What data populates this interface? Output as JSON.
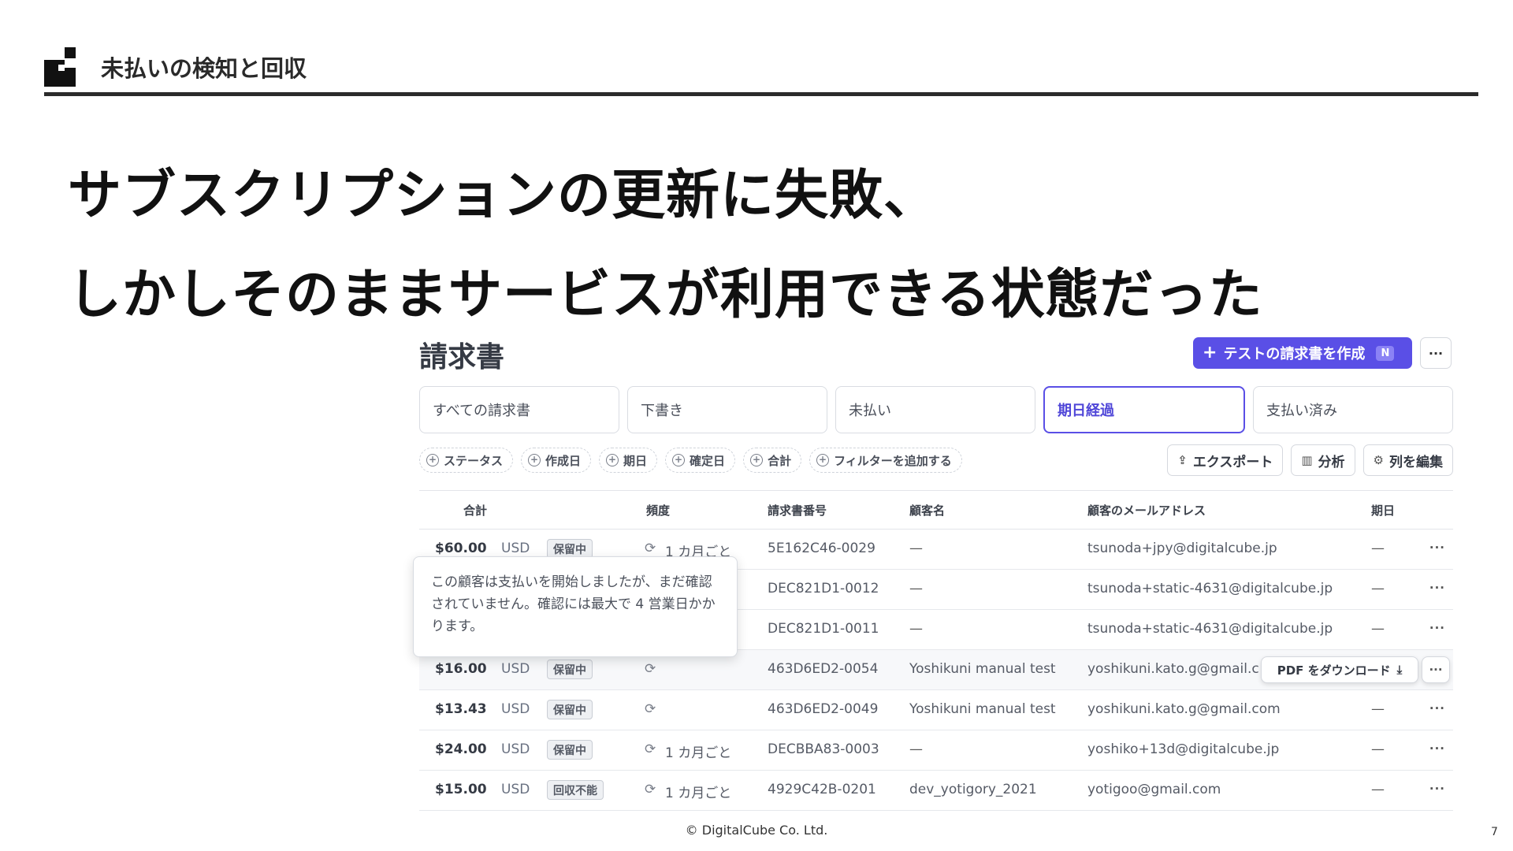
{
  "slide": {
    "section_title": "未払いの検知と回収",
    "headline_1": "サブスクリプションの更新に失敗、",
    "headline_2": "しかしそのままサービスが利用できる状態だった",
    "footer": "© DigitalCube Co. Ltd.",
    "page_number": "7"
  },
  "invoices": {
    "title": "請求書",
    "create_button": "テストの請求書を作成",
    "create_badge": "N",
    "more_label": "···",
    "tabs": [
      "すべての請求書",
      "下書き",
      "未払い",
      "期日経過",
      "支払い済み"
    ],
    "active_tab": "期日経過",
    "filters": [
      "ステータス",
      "作成日",
      "期日",
      "確定日",
      "合計",
      "フィルターを追加する"
    ],
    "actions": {
      "export": "エクスポート",
      "analyze": "分析",
      "edit_columns": "列を編集"
    },
    "columns": [
      "合計",
      "頻度",
      "請求書番号",
      "顧客名",
      "顧客のメールアドレス",
      "期日"
    ],
    "rows": [
      {
        "amount": "$60.00",
        "currency": "USD",
        "status": "保留中",
        "freq": "1 カ月ごと",
        "number": "5E162C46-0029",
        "customer": "—",
        "email": "tsunoda+jpy@digitalcube.jp",
        "due": "—"
      },
      {
        "amount": "",
        "currency": "",
        "status": "",
        "freq": "",
        "number": "DEC821D1-0012",
        "customer": "—",
        "email": "tsunoda+static-4631@digitalcube.jp",
        "due": "—"
      },
      {
        "amount": "",
        "currency": "",
        "status": "",
        "freq": "",
        "number": "DEC821D1-0011",
        "customer": "—",
        "email": "tsunoda+static-4631@digitalcube.jp",
        "due": "—"
      },
      {
        "amount": "$16.00",
        "currency": "USD",
        "status": "保留中",
        "freq": "",
        "number": "463D6ED2-0054",
        "customer": "Yoshikuni manual test",
        "email": "yoshikuni.kato.g@gmail.c",
        "due": ""
      },
      {
        "amount": "$13.43",
        "currency": "USD",
        "status": "保留中",
        "freq": "",
        "number": "463D6ED2-0049",
        "customer": "Yoshikuni manual test",
        "email": "yoshikuni.kato.g@gmail.com",
        "due": "—"
      },
      {
        "amount": "$24.00",
        "currency": "USD",
        "status": "保留中",
        "freq": "1 カ月ごと",
        "number": "DECBBA83-0003",
        "customer": "—",
        "email": "yoshiko+13d@digitalcube.jp",
        "due": "—"
      },
      {
        "amount": "$15.00",
        "currency": "USD",
        "status": "回収不能",
        "freq": "1 カ月ごと",
        "number": "4929C42B-0201",
        "customer": "dev_yotigory_2021",
        "email": "yotigoo@gmail.com",
        "due": "—"
      }
    ],
    "pdf_download": "PDF をダウンロード",
    "tooltip": "この顧客は支払いを開始しましたが、まだ確認されていません。確認には最大で 4 営業日かかります。"
  },
  "colors": {
    "accent": "#5a4fe6",
    "text": "#1a1a1a"
  }
}
